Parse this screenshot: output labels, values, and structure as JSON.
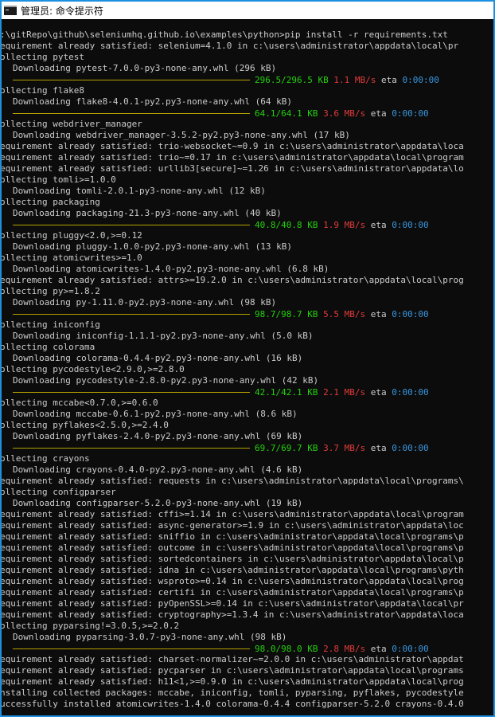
{
  "window": {
    "title": "管理员: 命令提示符",
    "border_color": "#1e90e0",
    "background": "#0c0c0c",
    "icon": "cmd-icon"
  },
  "colors": {
    "text": "#cccccc",
    "progress_bar": "#b5a000",
    "size": "#23d10c",
    "speed": "#e03b3b",
    "eta": "#3a96dd"
  },
  "lines": [
    {
      "t": "text",
      "text": ":\\gitRepo\\github\\seleniumhq.github.io\\examples\\python>pip install -r requirements.txt"
    },
    {
      "t": "text",
      "text": "equirement already satisfied: selenium=4.1.0 in c:\\users\\administrator\\appdata\\local\\pr"
    },
    {
      "t": "text",
      "text": "ollecting pytest"
    },
    {
      "t": "indent",
      "text": "Downloading pytest-7.0.0-py3-none-any.whl (296 kB)"
    },
    {
      "t": "progress",
      "size": "296.5/296.5 KB",
      "speed": "1.1 MB/s",
      "eta_label": "eta",
      "eta": "0:00:00"
    },
    {
      "t": "text",
      "text": "ollecting flake8"
    },
    {
      "t": "indent",
      "text": "Downloading flake8-4.0.1-py2.py3-none-any.whl (64 kB)"
    },
    {
      "t": "progress",
      "size": "64.1/64.1 KB",
      "speed": "3.6 MB/s",
      "eta_label": "eta",
      "eta": "0:00:00"
    },
    {
      "t": "text",
      "text": "ollecting webdriver_manager"
    },
    {
      "t": "indent",
      "text": "Downloading webdriver_manager-3.5.2-py2.py3-none-any.whl (17 kB)"
    },
    {
      "t": "text",
      "text": "equirement already satisfied: trio-websocket~=0.9 in c:\\users\\administrator\\appdata\\loca"
    },
    {
      "t": "text",
      "text": "equirement already satisfied: trio~=0.17 in c:\\users\\administrator\\appdata\\local\\program"
    },
    {
      "t": "text",
      "text": "equirement already satisfied: urllib3[secure]~=1.26 in c:\\users\\administrator\\appdata\\lo"
    },
    {
      "t": "text",
      "text": "ollecting tomli>=1.0.0"
    },
    {
      "t": "indent",
      "text": "Downloading tomli-2.0.1-py3-none-any.whl (12 kB)"
    },
    {
      "t": "text",
      "text": "ollecting packaging"
    },
    {
      "t": "indent",
      "text": "Downloading packaging-21.3-py3-none-any.whl (40 kB)"
    },
    {
      "t": "progress",
      "size": "40.8/40.8 KB",
      "speed": "1.9 MB/s",
      "eta_label": "eta",
      "eta": "0:00:00"
    },
    {
      "t": "text",
      "text": "ollecting pluggy<2.0,>=0.12"
    },
    {
      "t": "indent",
      "text": "Downloading pluggy-1.0.0-py2.py3-none-any.whl (13 kB)"
    },
    {
      "t": "text",
      "text": "ollecting atomicwrites>=1.0"
    },
    {
      "t": "indent",
      "text": "Downloading atomicwrites-1.4.0-py2.py3-none-any.whl (6.8 kB)"
    },
    {
      "t": "text",
      "text": "equirement already satisfied: attrs>=19.2.0 in c:\\users\\administrator\\appdata\\local\\prog"
    },
    {
      "t": "text",
      "text": "ollecting py>=1.8.2"
    },
    {
      "t": "indent",
      "text": "Downloading py-1.11.0-py2.py3-none-any.whl (98 kB)"
    },
    {
      "t": "progress",
      "size": "98.7/98.7 KB",
      "speed": "5.5 MB/s",
      "eta_label": "eta",
      "eta": "0:00:00"
    },
    {
      "t": "text",
      "text": "ollecting iniconfig"
    },
    {
      "t": "indent",
      "text": "Downloading iniconfig-1.1.1-py2.py3-none-any.whl (5.0 kB)"
    },
    {
      "t": "text",
      "text": "ollecting colorama"
    },
    {
      "t": "indent",
      "text": "Downloading colorama-0.4.4-py2.py3-none-any.whl (16 kB)"
    },
    {
      "t": "text",
      "text": "ollecting pycodestyle<2.9.0,>=2.8.0"
    },
    {
      "t": "indent",
      "text": "Downloading pycodestyle-2.8.0-py2.py3-none-any.whl (42 kB)"
    },
    {
      "t": "progress",
      "size": "42.1/42.1 KB",
      "speed": "2.1 MB/s",
      "eta_label": "eta",
      "eta": "0:00:00"
    },
    {
      "t": "text",
      "text": "ollecting mccabe<0.7.0,>=0.6.0"
    },
    {
      "t": "indent",
      "text": "Downloading mccabe-0.6.1-py2.py3-none-any.whl (8.6 kB)"
    },
    {
      "t": "text",
      "text": "ollecting pyflakes<2.5.0,>=2.4.0"
    },
    {
      "t": "indent",
      "text": "Downloading pyflakes-2.4.0-py2.py3-none-any.whl (69 kB)"
    },
    {
      "t": "progress",
      "size": "69.7/69.7 KB",
      "speed": "3.7 MB/s",
      "eta_label": "eta",
      "eta": "0:00:00"
    },
    {
      "t": "text",
      "text": "ollecting crayons"
    },
    {
      "t": "indent",
      "text": "Downloading crayons-0.4.0-py2.py3-none-any.whl (4.6 kB)"
    },
    {
      "t": "text",
      "text": "equirement already satisfied: requests in c:\\users\\administrator\\appdata\\local\\programs\\"
    },
    {
      "t": "text",
      "text": "ollecting configparser"
    },
    {
      "t": "indent",
      "text": "Downloading configparser-5.2.0-py3-none-any.whl (19 kB)"
    },
    {
      "t": "text",
      "text": "equirement already satisfied: cffi>=1.14 in c:\\users\\administrator\\appdata\\local\\program"
    },
    {
      "t": "text",
      "text": "equirement already satisfied: async-generator>=1.9 in c:\\users\\administrator\\appdata\\loc"
    },
    {
      "t": "text",
      "text": "equirement already satisfied: sniffio in c:\\users\\administrator\\appdata\\local\\programs\\p"
    },
    {
      "t": "text",
      "text": "equirement already satisfied: outcome in c:\\users\\administrator\\appdata\\local\\programs\\p"
    },
    {
      "t": "text",
      "text": "equirement already satisfied: sortedcontainers in c:\\users\\administrator\\appdata\\local\\p"
    },
    {
      "t": "text",
      "text": "equirement already satisfied: idna in c:\\users\\administrator\\appdata\\local\\programs\\pyth"
    },
    {
      "t": "text",
      "text": "equirement already satisfied: wsproto>=0.14 in c:\\users\\administrator\\appdata\\local\\prog"
    },
    {
      "t": "text",
      "text": "equirement already satisfied: certifi in c:\\users\\administrator\\appdata\\local\\programs\\p"
    },
    {
      "t": "text",
      "text": "equirement already satisfied: pyOpenSSL>=0.14 in c:\\users\\administrator\\appdata\\local\\pr"
    },
    {
      "t": "text",
      "text": "equirement already satisfied: cryptography>=1.3.4 in c:\\users\\administrator\\appdata\\loca"
    },
    {
      "t": "text",
      "text": "ollecting pyparsing!=3.0.5,>=2.0.2"
    },
    {
      "t": "indent",
      "text": "Downloading pyparsing-3.0.7-py3-none-any.whl (98 kB)"
    },
    {
      "t": "progress",
      "size": "98.0/98.0 KB",
      "speed": "2.8 MB/s",
      "eta_label": "eta",
      "eta": "0:00:00"
    },
    {
      "t": "text",
      "text": "equirement already satisfied: charset-normalizer~=2.0.0 in c:\\users\\administrator\\appdat"
    },
    {
      "t": "text",
      "text": "equirement already satisfied: pycparser in c:\\users\\administrator\\appdata\\local\\programs"
    },
    {
      "t": "text",
      "text": "equirement already satisfied: h11<1,>=0.9.0 in c:\\users\\administrator\\appdata\\local\\prog"
    },
    {
      "t": "text",
      "text": "nstalling collected packages: mccabe, iniconfig, tomli, pyparsing, pyflakes, pycodestyle"
    },
    {
      "t": "text",
      "text": "uccessfully installed atomicwrites-1.4.0 colorama-0.4.4 configparser-5.2.0 crayons-0.4.0"
    }
  ]
}
